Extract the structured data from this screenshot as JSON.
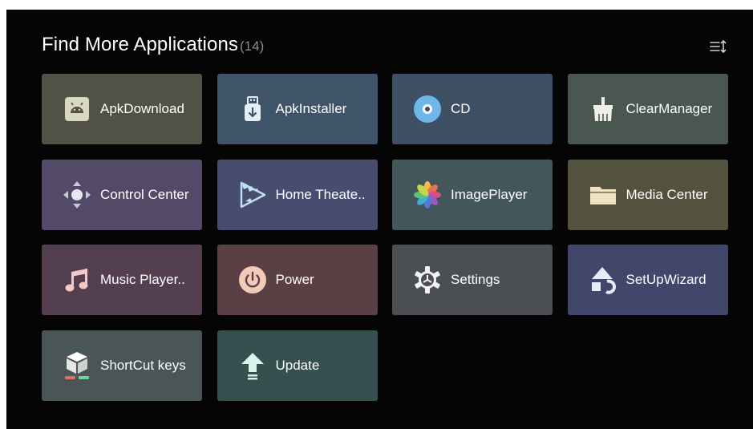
{
  "header": {
    "title": "Find More Applications",
    "count": "(14)",
    "sort_icon": "sort-list-icon"
  },
  "apps": [
    {
      "label": "ApkDownload",
      "icon": "android-download-icon",
      "color": "#4f5245"
    },
    {
      "label": "ApkInstaller",
      "icon": "usb-installer-icon",
      "color": "#3f5468"
    },
    {
      "label": "CD",
      "icon": "cd-disc-icon",
      "color": "#3e5064"
    },
    {
      "label": "ClearManager",
      "icon": "broom-icon",
      "color": "#4a5650"
    },
    {
      "label": "Control Center",
      "icon": "directional-pad-icon",
      "color": "#524a67"
    },
    {
      "label": "Home Theate..",
      "icon": "video-play-icon",
      "color": "#484d70"
    },
    {
      "label": "ImagePlayer",
      "icon": "pinwheel-icon",
      "color": "#42565c"
    },
    {
      "label": "Media Center",
      "icon": "folder-icon",
      "color": "#53523f"
    },
    {
      "label": "Music Player..",
      "icon": "music-note-icon",
      "color": "#533f4f"
    },
    {
      "label": "Power",
      "icon": "power-icon",
      "color": "#5a4045"
    },
    {
      "label": "Settings",
      "icon": "gear-icon",
      "color": "#4b4e52"
    },
    {
      "label": "SetUpWizard",
      "icon": "shapes-icon",
      "color": "#40476a"
    },
    {
      "label": "ShortCut keys",
      "icon": "cube-keys-icon",
      "color": "#4a5558"
    },
    {
      "label": "Update",
      "icon": "upload-arrow-icon",
      "color": "#35504f"
    }
  ]
}
